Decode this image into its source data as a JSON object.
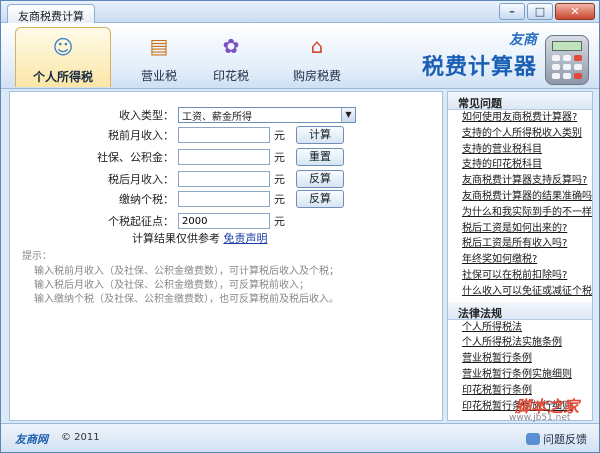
{
  "window": {
    "title": "友商税费计算",
    "buttons": {
      "min": "–",
      "max": "□",
      "close": "✕"
    }
  },
  "toolbar": {
    "tabs": [
      {
        "label": "个人所得税",
        "icon": "☺"
      },
      {
        "label": "营业税",
        "icon": "▤"
      },
      {
        "label": "印花税",
        "icon": "✿"
      },
      {
        "label": "购房税费",
        "icon": "⌂"
      }
    ],
    "brand_small": "友商",
    "brand_big": "税费计算器"
  },
  "form": {
    "income_type_label": "收入类型：",
    "income_type_value": "工资、薪金所得",
    "pre_tax_label": "税前月收入：",
    "pre_tax_value": "",
    "social_label": "社保、公积金：",
    "social_value": "",
    "after_tax_label": "税后月收入：",
    "after_tax_value": "",
    "tax_paid_label": "缴纳个税：",
    "tax_paid_value": "",
    "threshold_label": "个税起征点：",
    "threshold_value": "2000",
    "unit": "元",
    "btn_calc": "计算",
    "btn_reset": "重置",
    "btn_reverse1": "反算",
    "btn_reverse2": "反算",
    "disclaimer_text": "计算结果仅供参考",
    "disclaimer_link": "免责声明"
  },
  "tips": {
    "header": "提示：",
    "lines": [
      "输入税前月收入（及社保、公积金缴费数），可计算税后收入及个税；",
      "输入税后月收入（及社保、公积金缴费数），可反算税前收入；",
      "输入缴纳个税（及社保、公积金缴费数），也可反算税前及税后收入。"
    ]
  },
  "sidebar": {
    "faq_title": "常见问题",
    "faq": [
      "如何使用友商税费计算器?",
      "支持的个人所得税收入类别",
      "支持的营业税科目",
      "支持的印花税科目",
      "友商税费计算器支持反算吗?",
      "友商税费计算器的结果准确吗?",
      "为什么和我实际到手的不一样?",
      "税后工资是如何出来的?",
      "税后工资是所有收入吗?",
      "年终奖如何缴税?",
      "社保可以在税前扣除吗?",
      "什么收入可以免征或减征个税?"
    ],
    "law_title": "法律法规",
    "laws": [
      "个人所得税法",
      "个人所得税法实施条例",
      "营业税暂行条例",
      "营业税暂行条例实施细则",
      "印花税暂行条例",
      "印花税暂行条例施行细则"
    ]
  },
  "watermark": {
    "text": "脚本之家",
    "url": "www.jb51.net"
  },
  "status": {
    "logo": "友商网",
    "copyright": "© 2011",
    "feedback": "问题反馈"
  }
}
